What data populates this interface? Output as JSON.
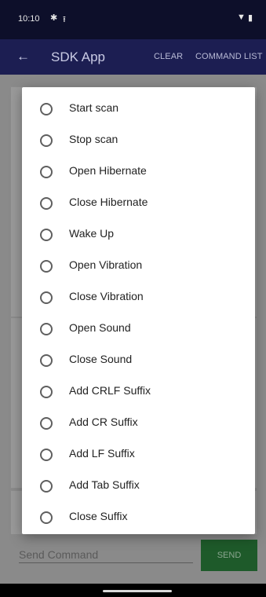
{
  "status_bar": {
    "time": "10:10"
  },
  "app_bar": {
    "title": "SDK App",
    "clear_label": "CLEAR",
    "command_list_label": "COMMAND LIST"
  },
  "send": {
    "placeholder": "Send Command",
    "button_label": "SEND"
  },
  "dialog": {
    "options": [
      {
        "label": "Start scan"
      },
      {
        "label": "Stop scan"
      },
      {
        "label": "Open Hibernate"
      },
      {
        "label": "Close Hibernate"
      },
      {
        "label": "Wake Up"
      },
      {
        "label": "Open Vibration"
      },
      {
        "label": "Close Vibration"
      },
      {
        "label": "Open Sound"
      },
      {
        "label": "Close Sound"
      },
      {
        "label": "Add CRLF Suffix"
      },
      {
        "label": "Add CR Suffix"
      },
      {
        "label": "Add LF Suffix"
      },
      {
        "label": "Add Tab Suffix"
      },
      {
        "label": "Close Suffix"
      }
    ]
  },
  "colors": {
    "app_bar": "#1c1e52",
    "status_bar": "#0d0f2a",
    "send_button": "#1e5a2a",
    "radio": "#5f5f5f"
  }
}
